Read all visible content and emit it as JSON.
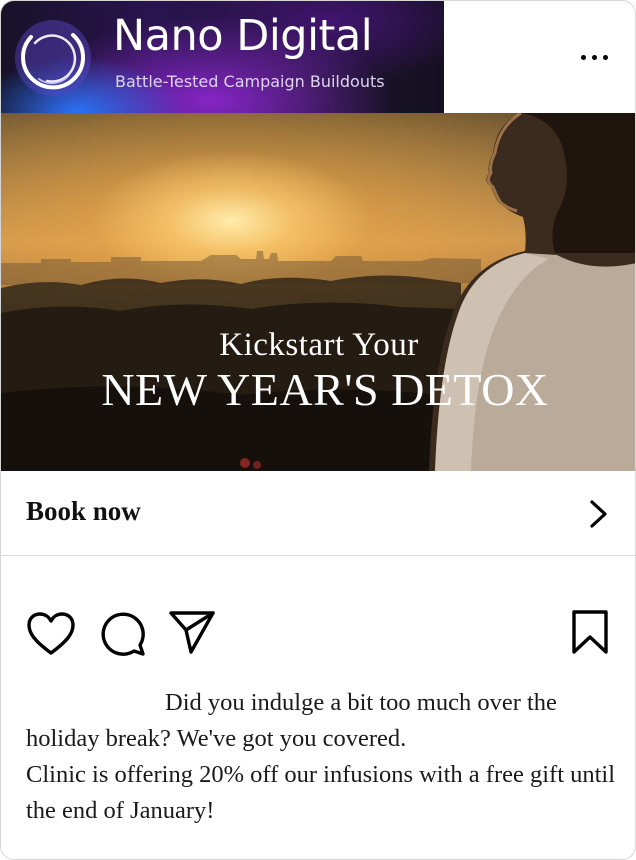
{
  "header": {
    "brand_name": "Nano Digital",
    "tagline": "Battle-Tested Campaign Buildouts",
    "logo_icon": "ring-logo-icon",
    "more_icon": "more-horizontal-icon"
  },
  "hero": {
    "line1": "Kickstart Your",
    "line2": "NEW YEAR'S DETOX"
  },
  "cta": {
    "label": "Book now",
    "icon": "chevron-right-icon"
  },
  "actions": {
    "icons": [
      "heart-icon",
      "comment-icon",
      "send-icon",
      "bookmark-icon"
    ]
  },
  "caption": {
    "line1": "Did you indulge a bit too much over the holiday break? We've got you covered.",
    "line2": "Clinic is offering 20% off our infusions with a free gift until the end of January!"
  },
  "colors": {
    "brand_gradient_start": "#171228",
    "brand_gradient_purple": "#9628dc",
    "brand_gradient_blue": "#2878ff",
    "text": "#111111"
  }
}
